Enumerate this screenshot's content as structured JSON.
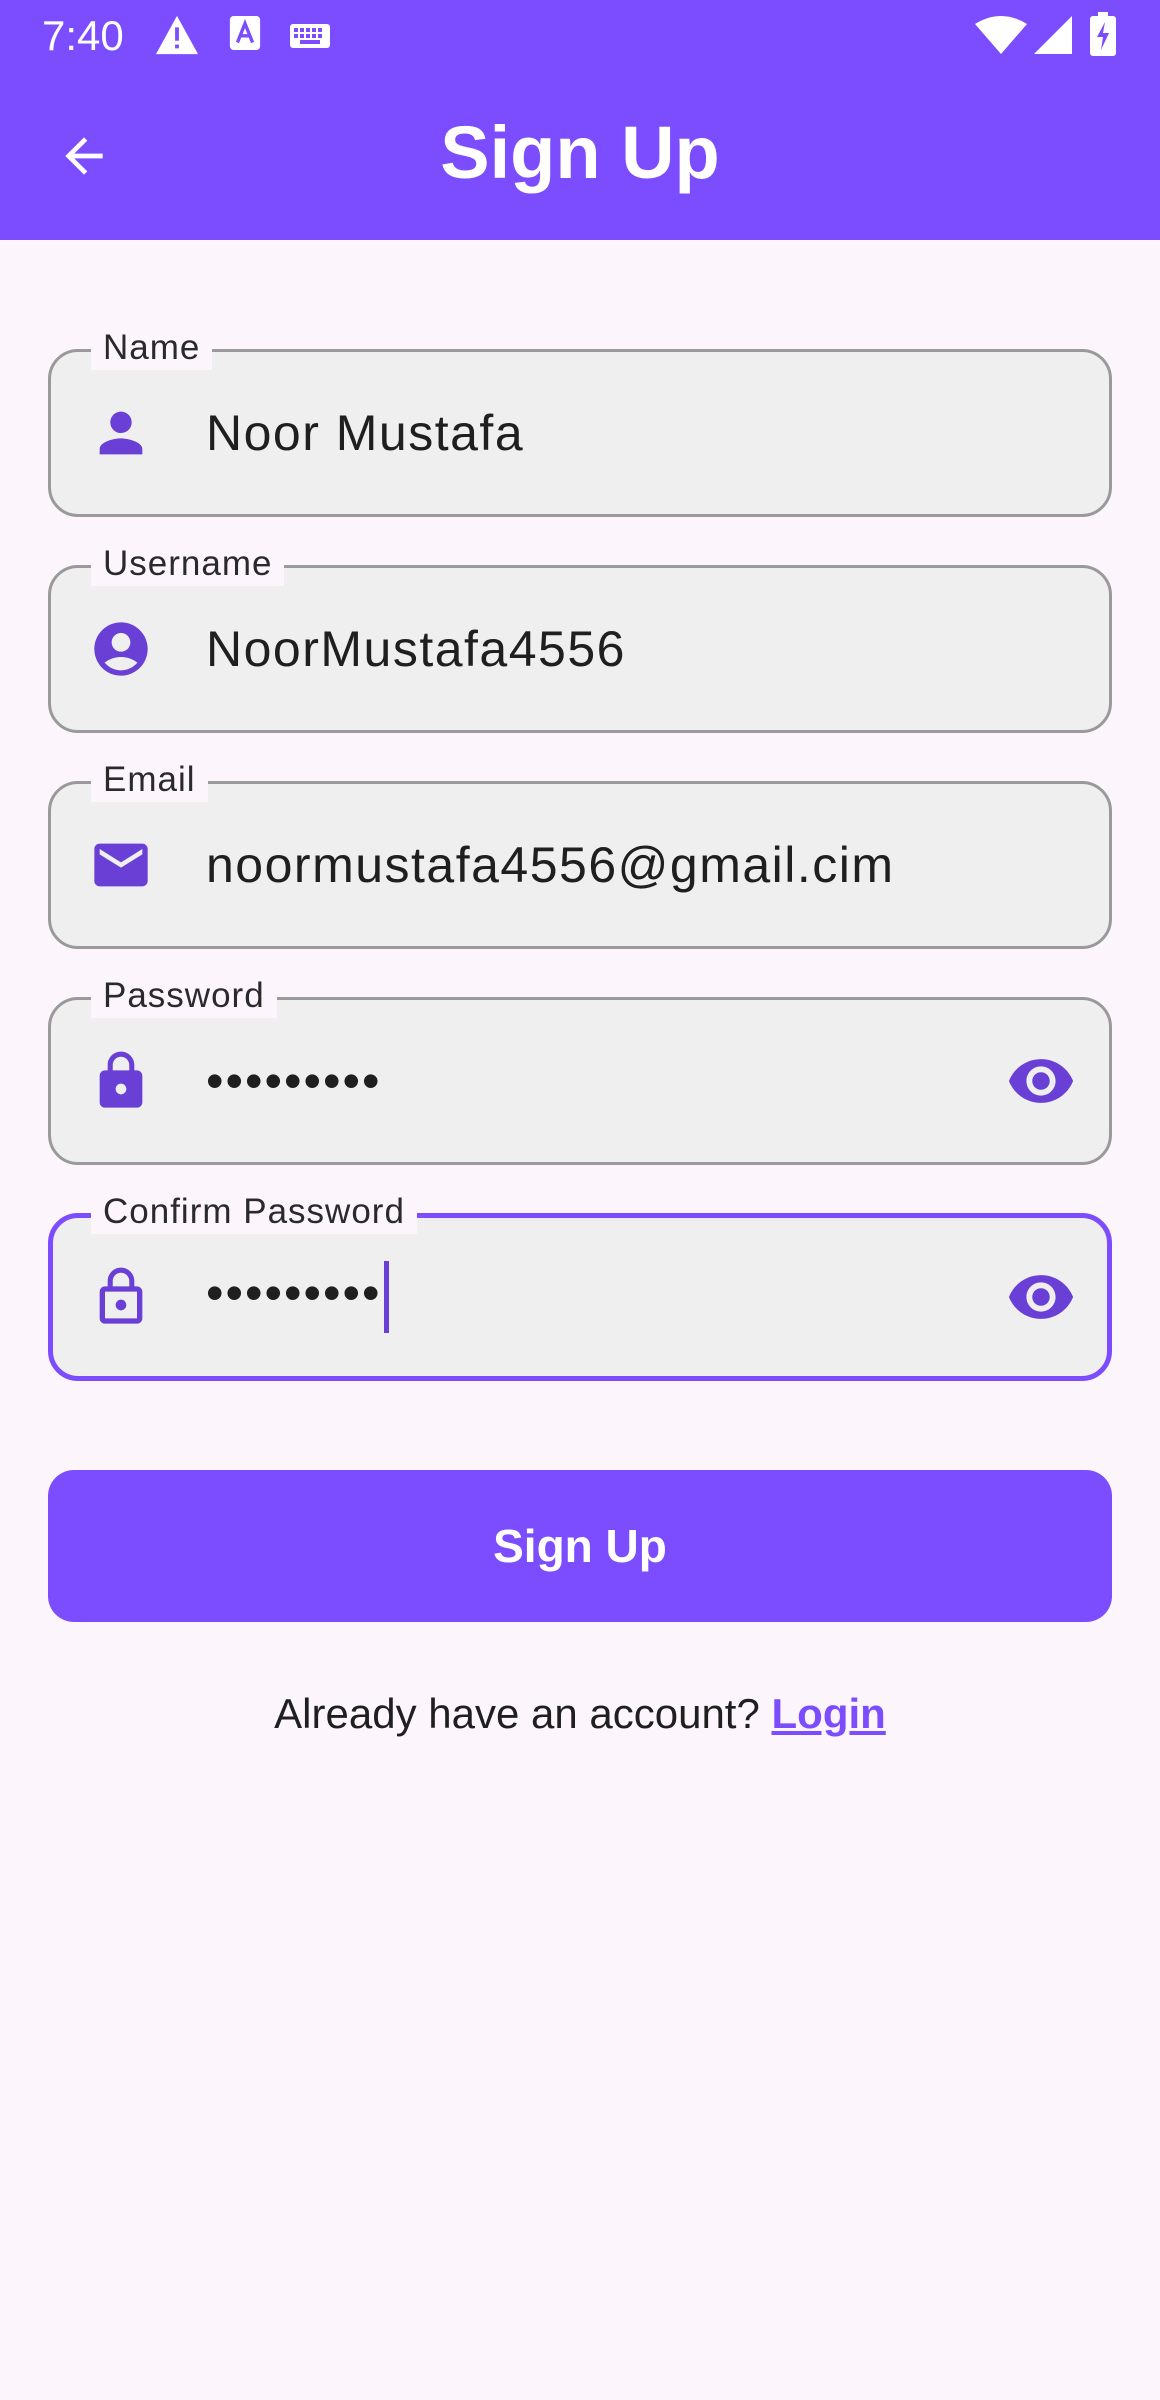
{
  "status_bar": {
    "time": "7:40",
    "left_icons": [
      "alert-triangle-icon",
      "translate-a-icon",
      "keyboard-icon"
    ],
    "right_icons": [
      "wifi-icon",
      "cell-signal-icon",
      "battery-charging-icon"
    ]
  },
  "app_bar": {
    "title": "Sign Up",
    "back_icon": "arrow-back-icon"
  },
  "form": {
    "name": {
      "label": "Name",
      "value": "Noor Mustafa",
      "icon": "person-icon"
    },
    "username": {
      "label": "Username",
      "value": "NoorMustafa4556",
      "icon": "account-circle-icon"
    },
    "email": {
      "label": "Email",
      "value": "noormustafa4556@gmail.cim",
      "icon": "mail-icon"
    },
    "password": {
      "label": "Password",
      "value": "•••••••••",
      "icon": "lock-icon",
      "toggle_icon": "eye-icon"
    },
    "confirm_password": {
      "label": "Confirm Password",
      "value": "•••••••••",
      "icon": "lock-outline-icon",
      "toggle_icon": "eye-icon",
      "focused": true
    }
  },
  "submit": {
    "label": "Sign Up"
  },
  "footer": {
    "prompt": "Already have an account? ",
    "link": "Login"
  },
  "colors": {
    "primary": "#7c4dff",
    "icon": "#6a3fd6",
    "background": "#fcf5fc",
    "field_fill": "#efefef",
    "field_border": "#9a9a9a"
  }
}
